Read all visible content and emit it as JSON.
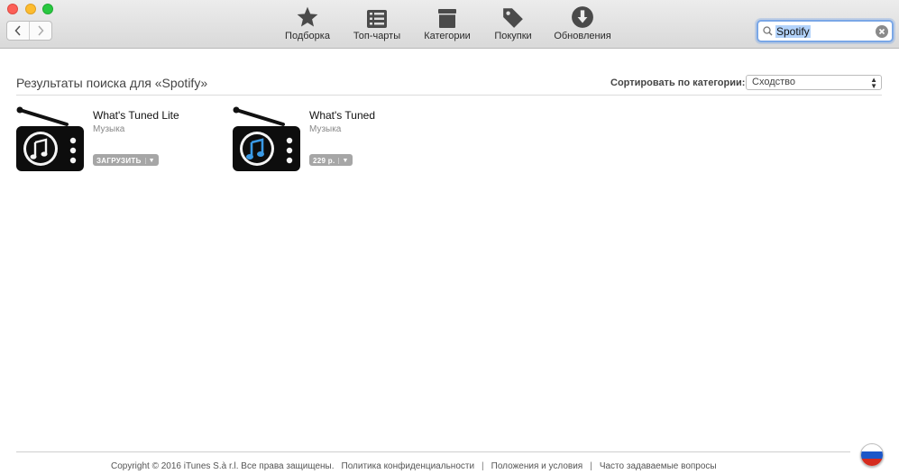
{
  "toolbar": {
    "tabs": [
      {
        "label": "Подборка",
        "icon": "star-icon"
      },
      {
        "label": "Топ-чарты",
        "icon": "list-icon"
      },
      {
        "label": "Категории",
        "icon": "box-icon"
      },
      {
        "label": "Покупки",
        "icon": "tag-icon"
      },
      {
        "label": "Обновления",
        "icon": "download-icon"
      }
    ],
    "search": {
      "value": "Spotify"
    }
  },
  "results": {
    "heading": "Результаты поиска для «Spotify»",
    "sort_label": "Сортировать по категории:",
    "sort_value": "Сходство",
    "apps": [
      {
        "name": "What's Tuned Lite",
        "category": "Музыка",
        "action": "ЗАГРУЗИТЬ",
        "note_color": "#1a1a1a"
      },
      {
        "name": "What's Tuned",
        "category": "Музыка",
        "action": "229 р.",
        "note_color": "#3a9ae6"
      }
    ]
  },
  "footer": {
    "copyright": "Copyright © 2016 iTunes S.à r.l. Все права защищены.",
    "links": [
      "Политика конфиденциальности",
      "Положения и условия",
      "Часто задаваемые вопросы"
    ]
  },
  "colors": {
    "accent": "#7aa7e6",
    "flag": [
      "#ffffff",
      "#1c57c8",
      "#d52b1e"
    ]
  }
}
